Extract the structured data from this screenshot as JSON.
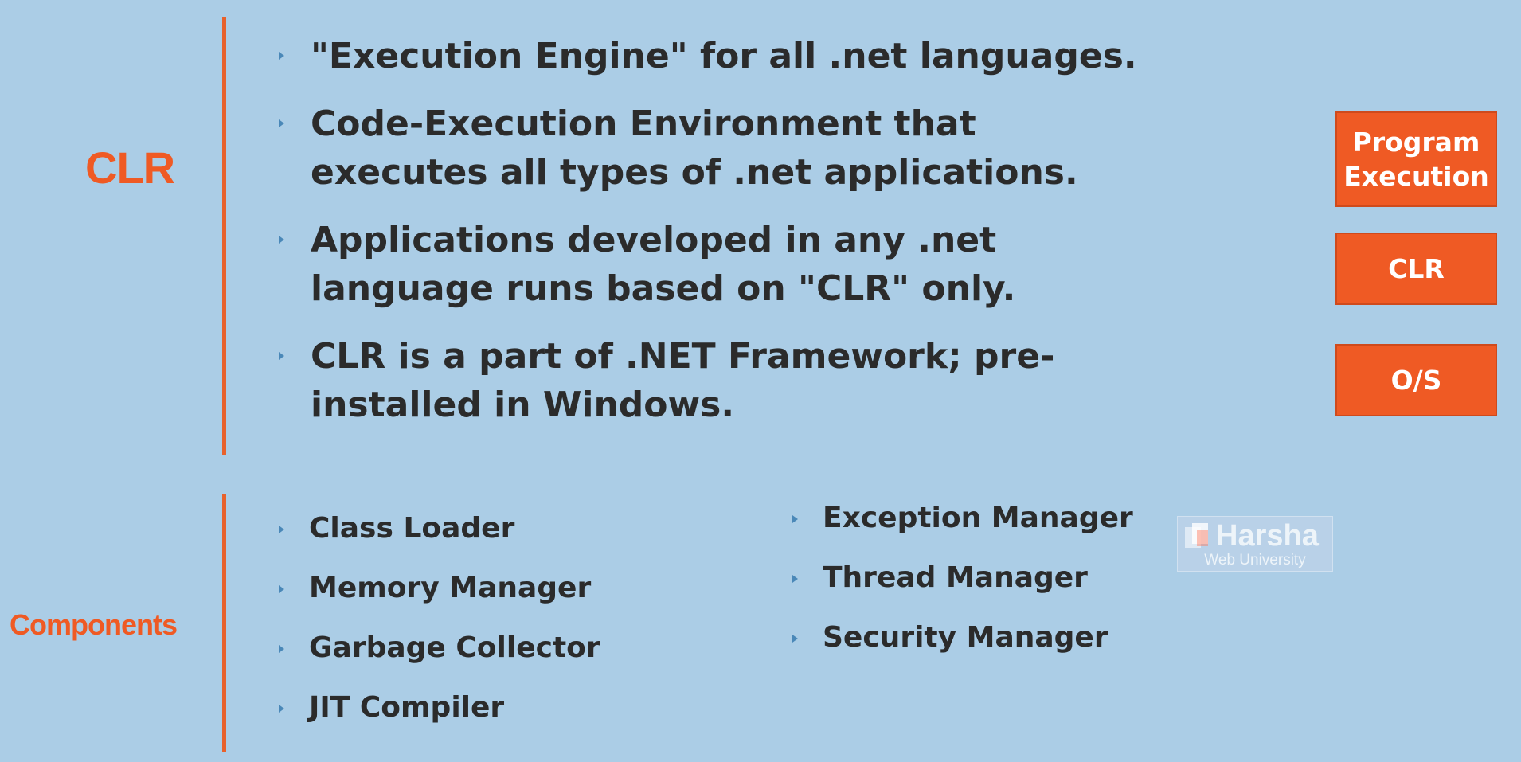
{
  "headings": {
    "clr": "CLR",
    "components": "Components"
  },
  "main_points": [
    {
      "text": "\"Execution Engine\" for all .net languages."
    },
    {
      "text": "Code-Execution Environment that executes all types of .net applications."
    },
    {
      "text": "Applications developed in any .net language runs based on \"CLR\" only."
    },
    {
      "text": "CLR is a part of .NET Framework; pre-installed in Windows."
    }
  ],
  "components_left": [
    {
      "label": "Class Loader"
    },
    {
      "label": "Memory Manager"
    },
    {
      "label": "Garbage Collector"
    },
    {
      "label": "JIT Compiler"
    }
  ],
  "components_right": [
    {
      "label": "Exception Manager"
    },
    {
      "label": "Thread Manager"
    },
    {
      "label": "Security Manager"
    }
  ],
  "stack": {
    "program_execution": "Program\nExecution",
    "clr": "CLR",
    "os": "O/S"
  },
  "watermark": {
    "name": "Harsha",
    "subtitle": "Web University"
  },
  "colors": {
    "background": "#abcde6",
    "accent": "#ef5a24",
    "text": "#2b2b2b",
    "bullet": "#4a88b8"
  },
  "icons": {
    "bullet": "triangle-bullet-icon",
    "watermark_logo": "harsha-logo-icon"
  }
}
